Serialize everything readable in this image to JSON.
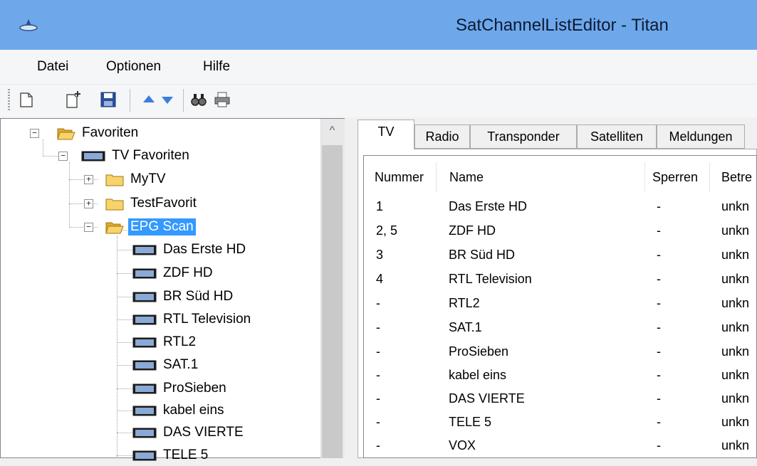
{
  "window": {
    "title": "SatChannelListEditor - Titan"
  },
  "menu": [
    "Datei",
    "Optionen",
    "Hilfe"
  ],
  "toolbar": {
    "buttons": [
      "new-file-icon",
      "new-item-icon",
      "save-icon",
      "move-up-icon",
      "move-down-icon",
      "find-icon",
      "print-icon"
    ]
  },
  "tree": {
    "root": "Favoriten",
    "tv_group": "TV Favoriten",
    "folders": [
      "MyTV",
      "TestFavorit",
      "EPG Scan"
    ],
    "selected_folder": "EPG Scan",
    "channels": [
      "Das Erste HD",
      "ZDF HD",
      "BR Süd HD",
      "RTL Television",
      "RTL2",
      "SAT.1",
      "ProSieben",
      "kabel eins",
      "DAS VIERTE",
      "TELE 5"
    ]
  },
  "tabs": [
    "TV",
    "Radio",
    "Transponder",
    "Satelliten",
    "Meldungen"
  ],
  "active_tab": "TV",
  "list": {
    "columns": [
      "Nummer",
      "Name",
      "Sperren",
      "Betre"
    ],
    "rows": [
      {
        "nummer": "1",
        "name": "Das Erste HD",
        "sperren": "-",
        "betre": "unkn"
      },
      {
        "nummer": "2, 5",
        "name": "ZDF HD",
        "sperren": "-",
        "betre": "unkn"
      },
      {
        "nummer": "3",
        "name": "BR Süd HD",
        "sperren": "-",
        "betre": "unkn"
      },
      {
        "nummer": "4",
        "name": "RTL Television",
        "sperren": "-",
        "betre": "unkn"
      },
      {
        "nummer": "-",
        "name": "RTL2",
        "sperren": "-",
        "betre": "unkn"
      },
      {
        "nummer": "-",
        "name": "SAT.1",
        "sperren": "-",
        "betre": "unkn"
      },
      {
        "nummer": "-",
        "name": "ProSieben",
        "sperren": "-",
        "betre": "unkn"
      },
      {
        "nummer": "-",
        "name": "kabel eins",
        "sperren": "-",
        "betre": "unkn"
      },
      {
        "nummer": "-",
        "name": "DAS VIERTE",
        "sperren": "-",
        "betre": "unkn"
      },
      {
        "nummer": "-",
        "name": "TELE 5",
        "sperren": "-",
        "betre": "unkn"
      },
      {
        "nummer": "-",
        "name": "VOX",
        "sperren": "-",
        "betre": "unkn"
      }
    ]
  },
  "colors": {
    "titlebar": "#6ea8eb",
    "selection": "#3399ff",
    "folder": "#f5c542"
  }
}
